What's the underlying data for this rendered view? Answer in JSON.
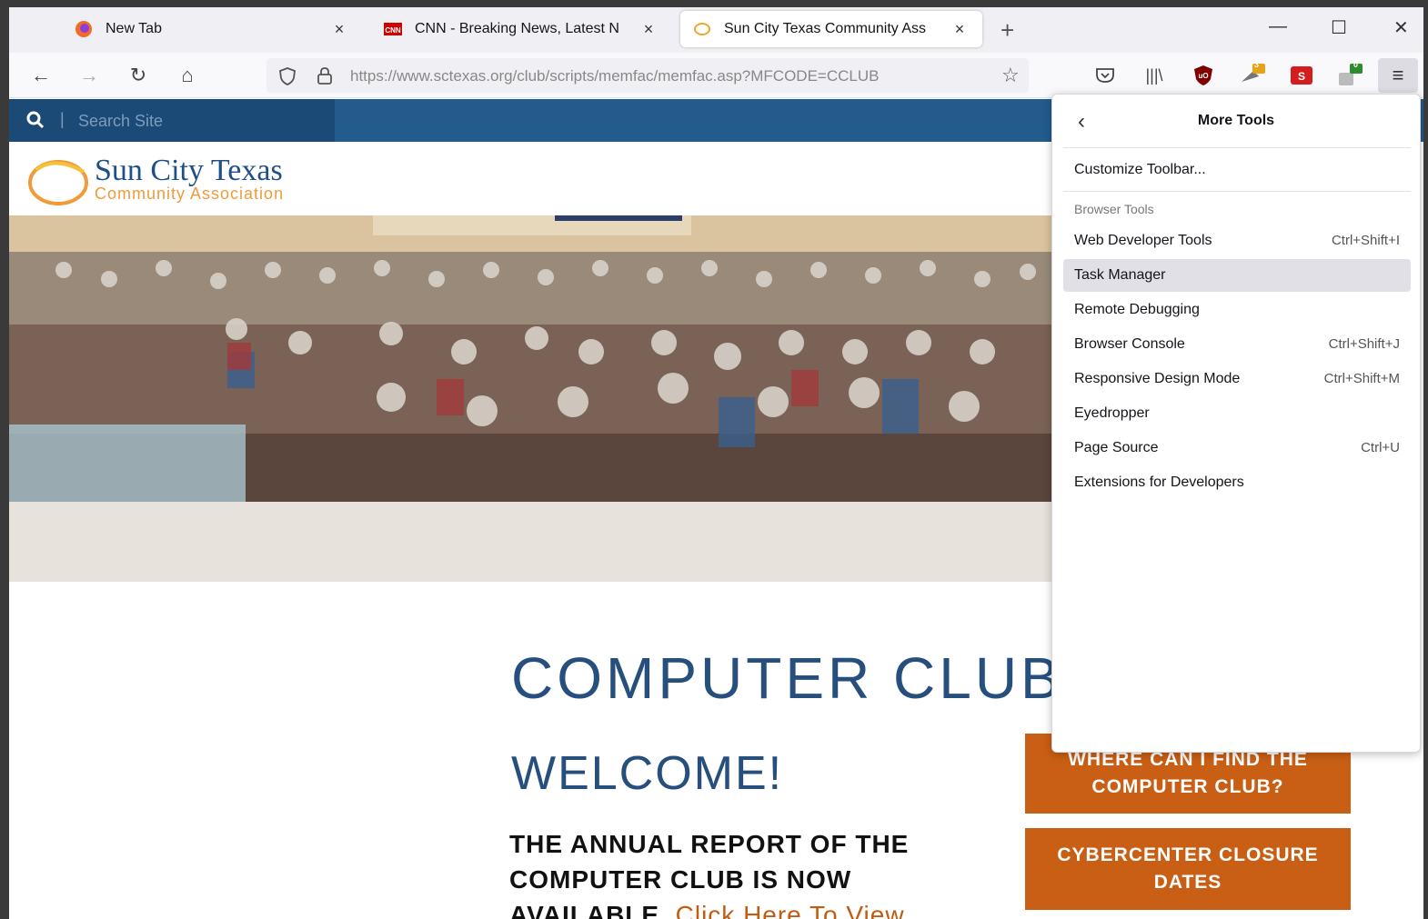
{
  "browser": {
    "tabs": [
      {
        "title": "New Tab",
        "icon": "firefox-icon"
      },
      {
        "title": "CNN - Breaking News, Latest N",
        "icon": "cnn-icon"
      },
      {
        "title": "Sun City Texas Community Ass",
        "icon": "sctexas-icon"
      }
    ],
    "url": "https://www.sctexas.org/club/scripts/memfac/memfac.asp?MFCODE=CCLUB",
    "extension_badges": {
      "zoom": "3",
      "translate": "0"
    }
  },
  "site": {
    "search_placeholder": "Search Site",
    "logo_main": "Sun City Texas",
    "logo_sub": "Community Association",
    "heading": "COMPUTER CLUB",
    "welcome": "WELCOME!",
    "annual_text": "THE ANNUAL REPORT OF THE COMPUTER CLUB IS NOW AVAILABLE.",
    "annual_link": "Click Here To View",
    "btn_where": "WHERE CAN I FIND THE COMPUTER CLUB?",
    "btn_closure": "CYBERCENTER CLOSURE DATES"
  },
  "menu": {
    "title": "More Tools",
    "customize": "Customize Toolbar...",
    "section": "Browser Tools",
    "items": [
      {
        "label": "Web Developer Tools",
        "shortcut": "Ctrl+Shift+I"
      },
      {
        "label": "Task Manager",
        "shortcut": ""
      },
      {
        "label": "Remote Debugging",
        "shortcut": ""
      },
      {
        "label": "Browser Console",
        "shortcut": "Ctrl+Shift+J"
      },
      {
        "label": "Responsive Design Mode",
        "shortcut": "Ctrl+Shift+M"
      },
      {
        "label": "Eyedropper",
        "shortcut": ""
      },
      {
        "label": "Page Source",
        "shortcut": "Ctrl+U"
      },
      {
        "label": "Extensions for Developers",
        "shortcut": ""
      }
    ]
  }
}
